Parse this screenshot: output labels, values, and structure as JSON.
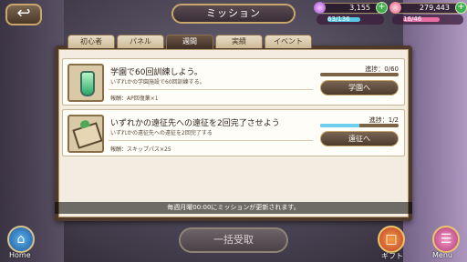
{
  "header": {
    "back_icon": "back-arrow-icon",
    "title": "ミッション",
    "resources": [
      {
        "value": "3,155",
        "icon": "gem-icon",
        "color": "#b36ad8"
      },
      {
        "value": "279,443",
        "icon": "heart-gem-icon",
        "color": "#e0587b"
      }
    ],
    "stamina": [
      {
        "label": "63/136",
        "fill": 0.46
      },
      {
        "label": "16/46",
        "fill": 0.35
      }
    ]
  },
  "tabs": [
    {
      "label": "初心者",
      "active": false
    },
    {
      "label": "パネル",
      "active": false
    },
    {
      "label": "週間",
      "active": true
    },
    {
      "label": "実績",
      "active": false
    },
    {
      "label": "イベント",
      "active": false
    }
  ],
  "missions": [
    {
      "title": "学園で60回訓練しよう。",
      "description": "いずれかの学園施設で60回訓練する。",
      "reward": "報酬：AP回復薬×1",
      "progress_label": "進捗：0/60",
      "progress": 0,
      "button": "学園へ",
      "icon": "potion-icon"
    },
    {
      "title": "いずれかの遠征先への遠征を2回完了させよう",
      "description": "いずれかの遠征先への遠征を2回完了する",
      "reward": "報酬：スキップパス×25",
      "progress_label": "進捗：1/2",
      "progress": 0.5,
      "button": "遠征へ",
      "icon": "skip-pass-icon"
    }
  ],
  "notice": "毎週月曜00:00にミッションが更新されます。",
  "bottom": {
    "bulk_receive": "一括受取",
    "home": "Home",
    "gift": "ギフト",
    "menu": "Menu"
  },
  "colors": {
    "panel_border": "#4d3a2a",
    "progress_fill": "#6ed0f0",
    "active_tab": "#3e2e24"
  }
}
